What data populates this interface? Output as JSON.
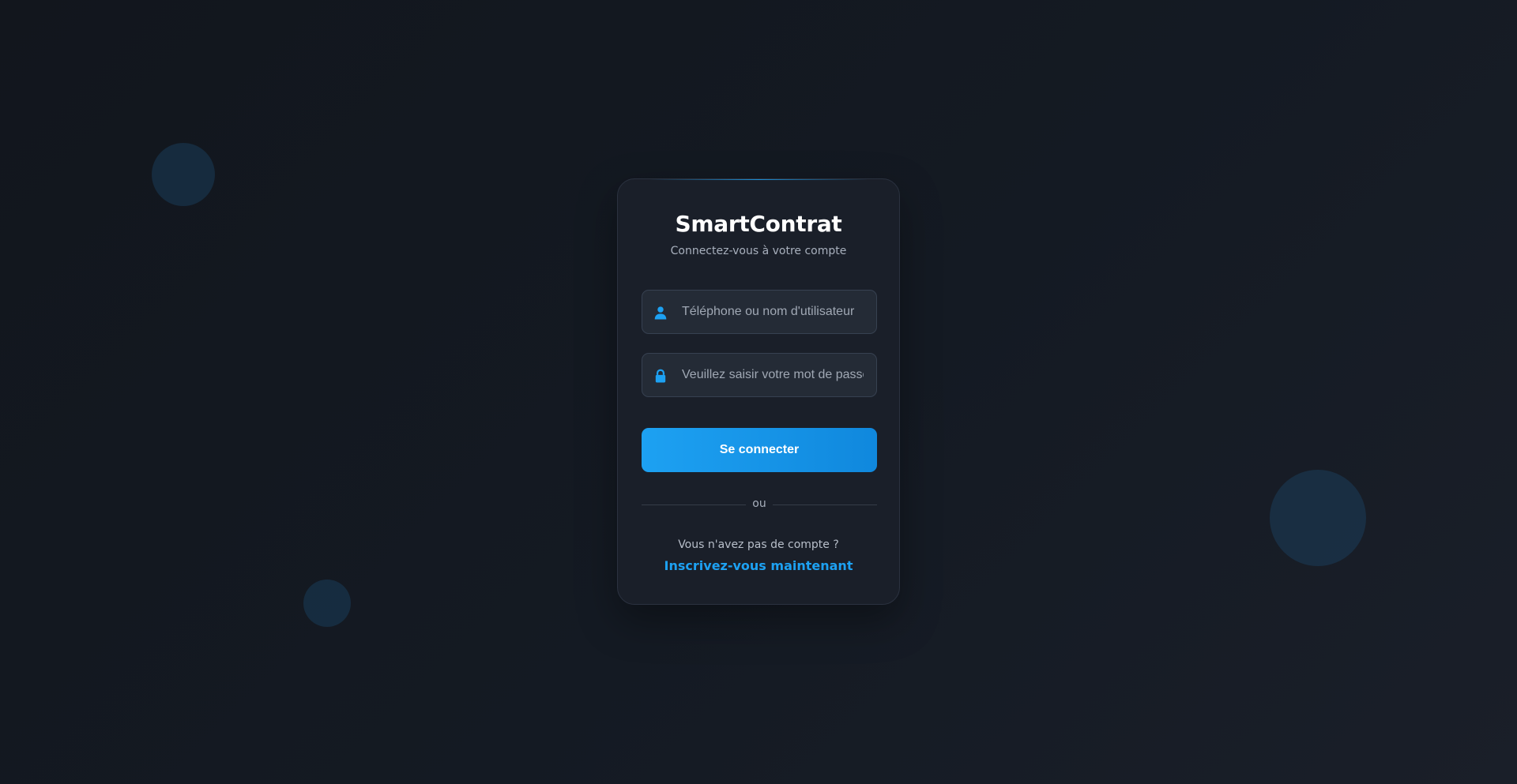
{
  "app": {
    "title": "SmartContrat",
    "subtitle": "Connectez-vous à votre compte"
  },
  "form": {
    "username": {
      "icon": "user-icon",
      "placeholder": "Téléphone ou nom d'utilisateur",
      "value": ""
    },
    "password": {
      "icon": "lock-icon",
      "placeholder": "Veuillez saisir votre mot de passe",
      "value": ""
    },
    "submit_label": "Se connecter"
  },
  "divider_label": "ou",
  "signup": {
    "prompt": "Vous n'avez pas de compte ?",
    "link_label": "Inscrivez-vous maintenant"
  },
  "colors": {
    "accent": "#1da1f2",
    "background": "#141a23",
    "card": "#1a1f29",
    "input": "#242b36"
  }
}
